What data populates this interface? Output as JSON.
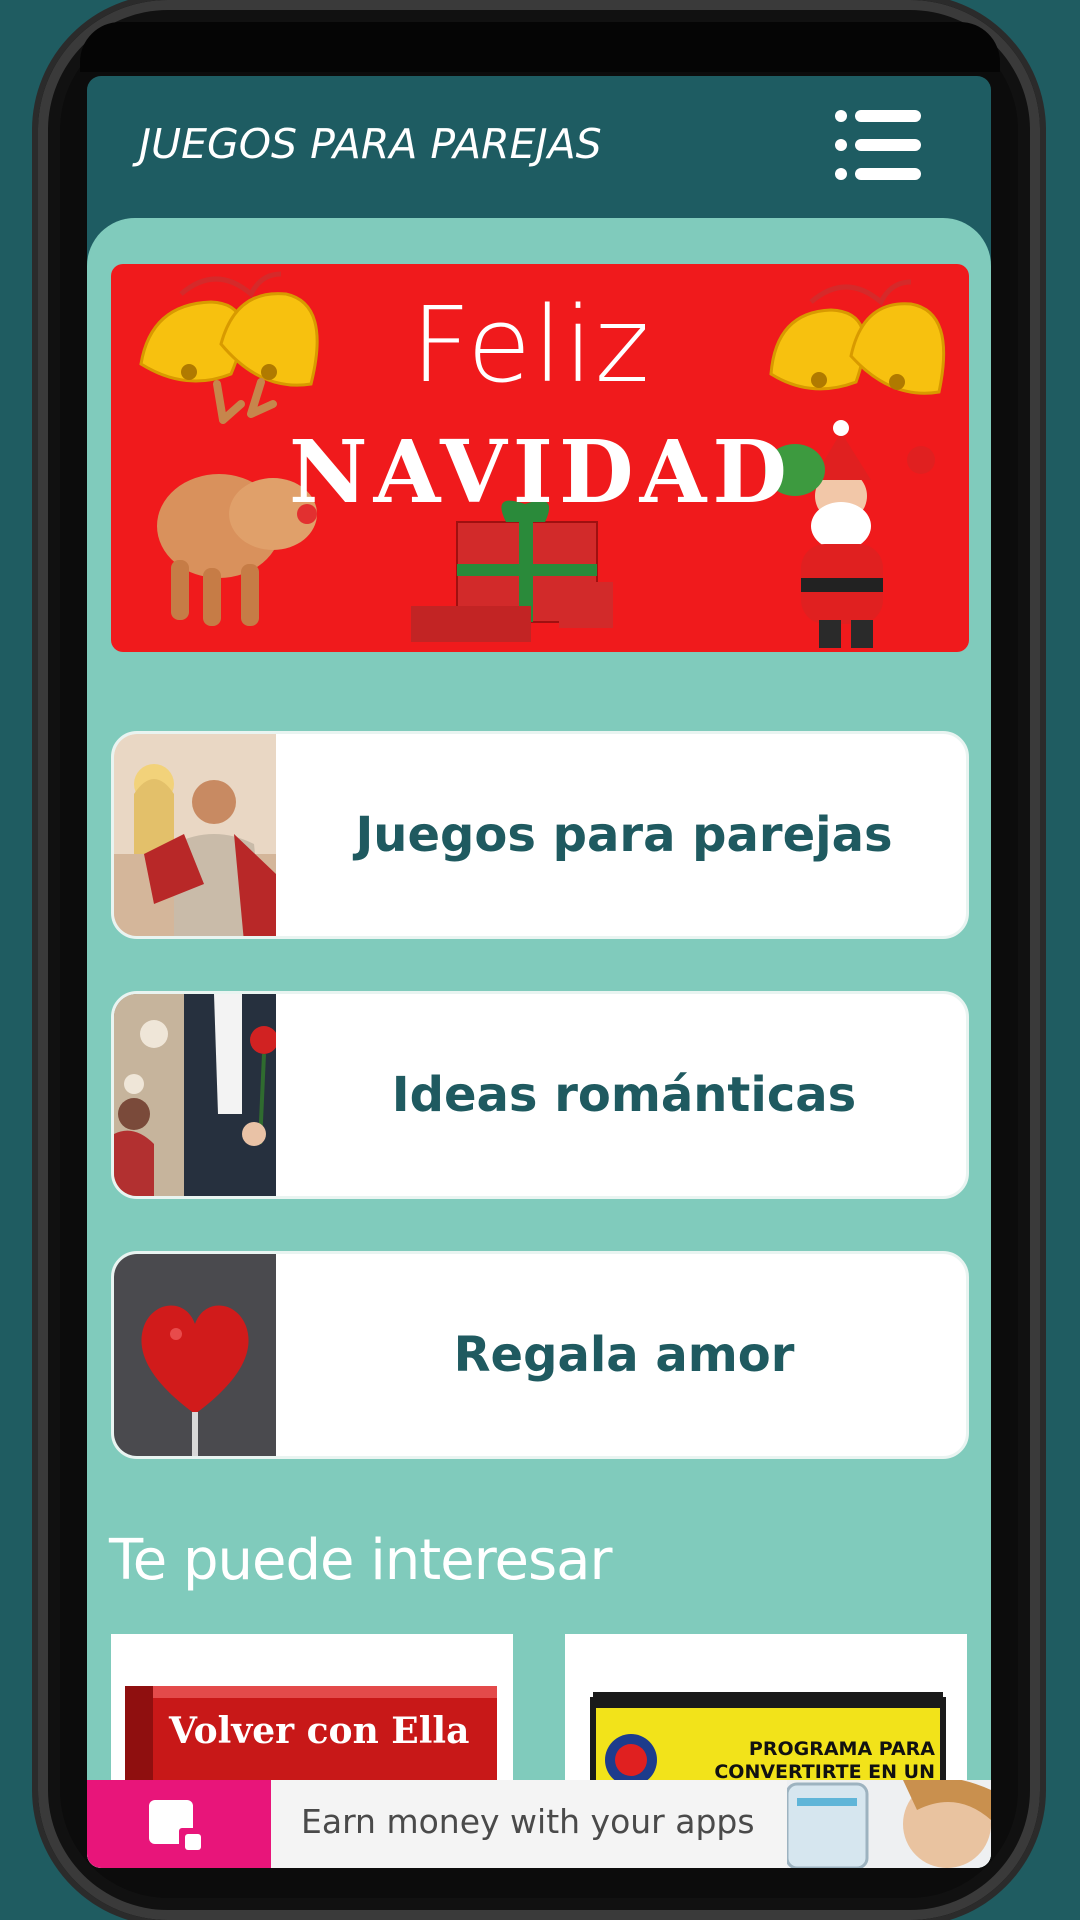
{
  "header": {
    "title": "JUEGOS PARA PAREJAS",
    "menu_icon": "hamburger-list-icon"
  },
  "banner": {
    "line1": "Feliz",
    "line2": "NAVIDAD"
  },
  "menu": {
    "items": [
      {
        "label": "Juegos para parejas",
        "thumb": "couple-photo"
      },
      {
        "label": "Ideas románticas",
        "thumb": "romantic-photo"
      },
      {
        "label": "Regala amor",
        "thumb": "heart-photo"
      }
    ]
  },
  "recommendations": {
    "title": "Te puede interesar",
    "items": [
      {
        "text": "Volver con Ella"
      },
      {
        "text_line1": "PROGRAMA PARA",
        "text_line2": "CONVERTIRTE EN UN ALFA"
      }
    ]
  },
  "ad": {
    "text": "Earn money with your apps",
    "accent_color": "#e8157a"
  },
  "colors": {
    "header_bg": "#1e5c62",
    "panel_bg": "#80cbbc",
    "label_text": "#1f5a60",
    "banner_bg": "#f01a1c"
  }
}
